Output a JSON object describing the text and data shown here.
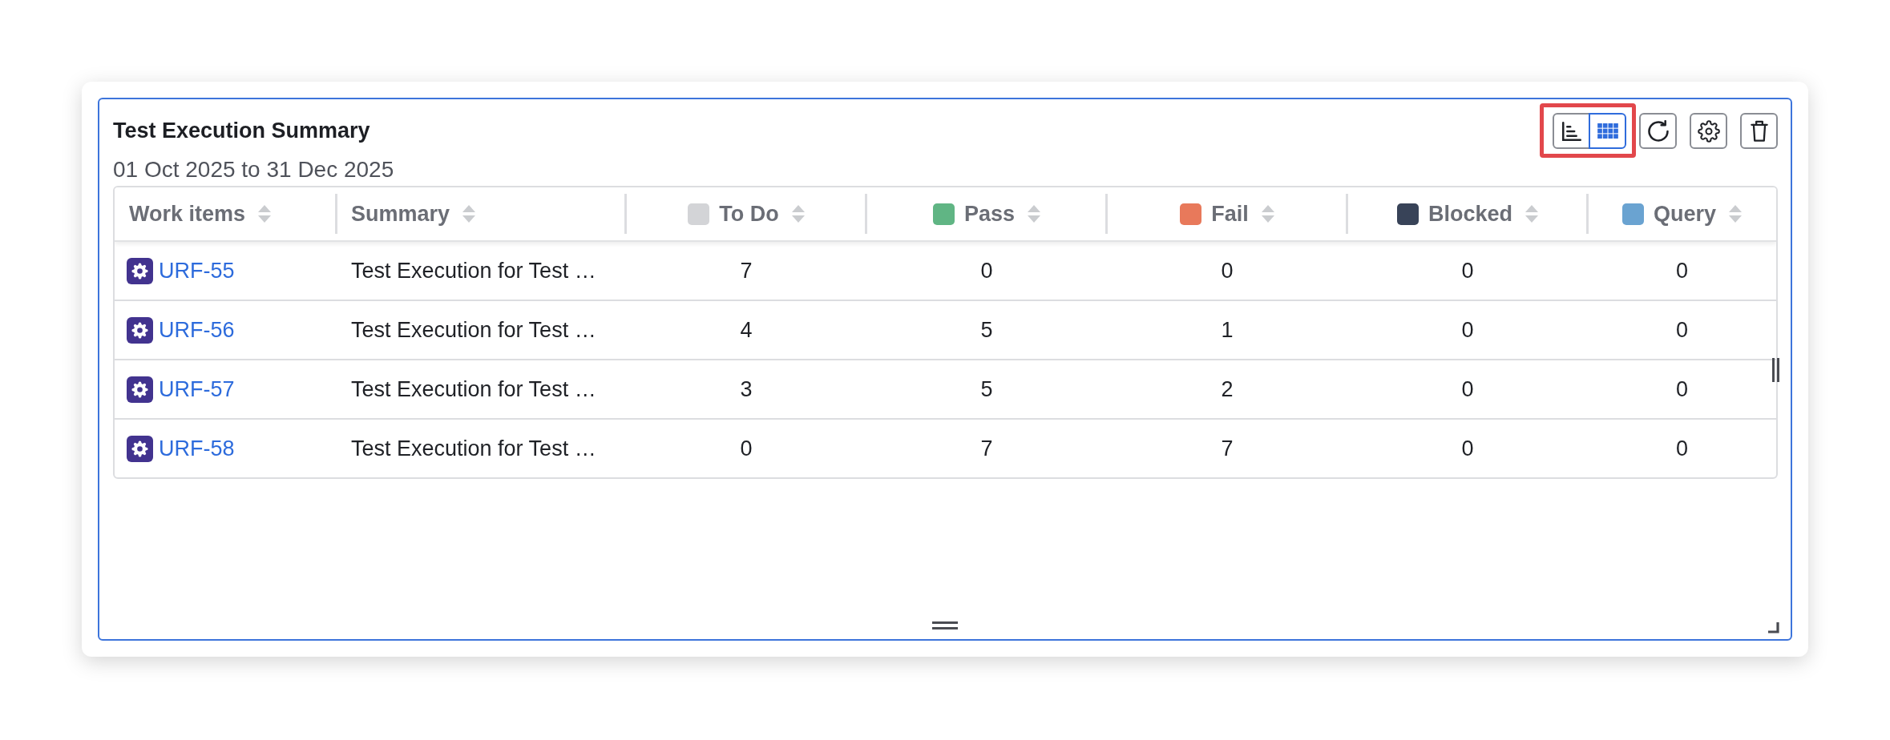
{
  "widget": {
    "title": "Test Execution Summary",
    "date_range": "01 Oct 2025 to 31 Dec 2025"
  },
  "toolbar": {
    "view_toggle": {
      "highlighted": true,
      "options": [
        {
          "kind": "chart",
          "selected": false
        },
        {
          "kind": "table",
          "selected": true
        }
      ]
    },
    "actions": [
      {
        "kind": "refresh"
      },
      {
        "kind": "settings"
      },
      {
        "kind": "delete"
      }
    ]
  },
  "table": {
    "columns": [
      {
        "label": "Work items",
        "kind": "key"
      },
      {
        "label": "Summary",
        "kind": "text"
      },
      {
        "label": "To Do",
        "kind": "count",
        "color": "#d3d4d7"
      },
      {
        "label": "Pass",
        "kind": "count",
        "color": "#60b584"
      },
      {
        "label": "Fail",
        "kind": "count",
        "color": "#e8795b"
      },
      {
        "label": "Blocked",
        "kind": "count",
        "color": "#384358"
      },
      {
        "label": "Query",
        "kind": "count",
        "color": "#6aa3d1"
      }
    ],
    "rows": [
      {
        "cells": [
          "URF-55",
          "Test Execution for Test …",
          "7",
          "0",
          "0",
          "0",
          "0"
        ]
      },
      {
        "cells": [
          "URF-56",
          "Test Execution for Test …",
          "4",
          "5",
          "1",
          "0",
          "0"
        ]
      },
      {
        "cells": [
          "URF-57",
          "Test Execution for Test …",
          "3",
          "5",
          "2",
          "0",
          "0"
        ]
      },
      {
        "cells": [
          "URF-58",
          "Test Execution for Test …",
          "0",
          "7",
          "7",
          "0",
          "0"
        ]
      }
    ]
  }
}
